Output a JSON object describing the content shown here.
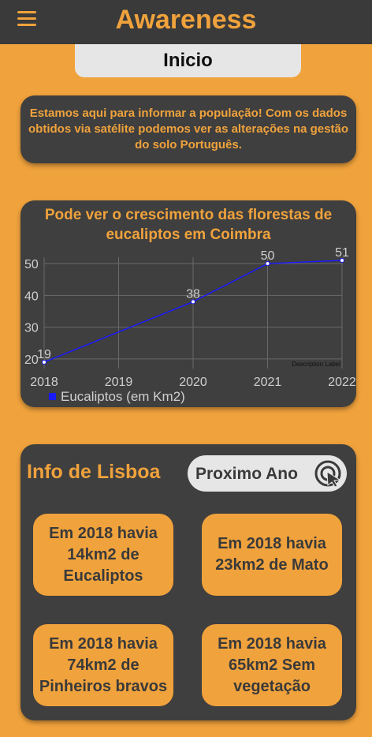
{
  "header": {
    "title": "Awareness",
    "menu_icon": "hamburger-menu-icon"
  },
  "tab": {
    "label": "Inicio"
  },
  "intro": {
    "text": "Estamos aqui para informar a população! Com os dados obtidos via satélite podemos ver as alterações na gestão do solo Português."
  },
  "chart_section": {
    "title": "Pode ver o crescimento das florestas de eucaliptos em Coimbra"
  },
  "chart_data": {
    "type": "line",
    "title": "Pode ver o crescimento das florestas de eucaliptos em Coimbra",
    "x": [
      2018,
      2019,
      2020,
      2021,
      2022
    ],
    "x_ticks": [
      "2018",
      "2019",
      "2020",
      "2021",
      "2022"
    ],
    "y_ticks": [
      "20",
      "30",
      "40",
      "50"
    ],
    "xlim": [
      2018,
      2022
    ],
    "ylim": [
      17,
      52
    ],
    "grid": true,
    "description_label": "Description Label",
    "legend_position": "bottom-left",
    "series": [
      {
        "name": "Eucaliptos (em Km2)",
        "color": "#1a1aff",
        "points": [
          {
            "x": 2018,
            "y": 19,
            "label": "19"
          },
          {
            "x": 2020,
            "y": 38,
            "label": "38"
          },
          {
            "x": 2021,
            "y": 50,
            "label": "50"
          },
          {
            "x": 2022,
            "y": 51,
            "label": "51"
          }
        ]
      }
    ]
  },
  "lisboa": {
    "title": "Info de Lisboa",
    "next_button": "Proximo Ano",
    "next_icon": "touch-tap-icon",
    "tiles": [
      "Em 2018 havia 14km2 de Eucaliptos",
      "Em 2018 havia 23km2 de Mato",
      "Em 2018 havia 74km2 de Pinheiros bravos",
      "Em 2018 havia 65km2 Sem vegetação"
    ]
  },
  "colors": {
    "accent": "#f0a23c",
    "card": "#3f3f3f",
    "topbar": "#3a3a3a",
    "pill": "#e6e6e6",
    "series": "#1a1aff"
  }
}
